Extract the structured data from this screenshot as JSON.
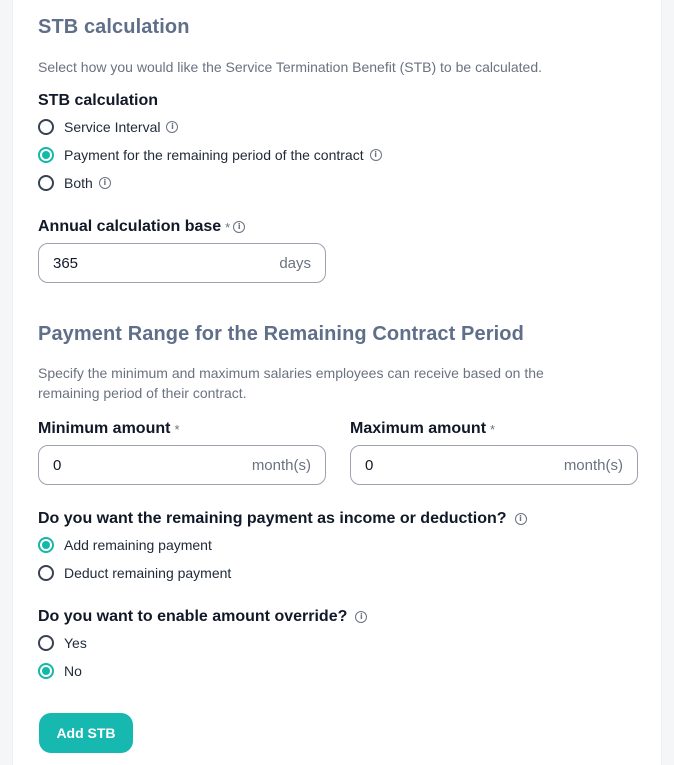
{
  "stb": {
    "heading": "STB calculation",
    "description": "Select how you would like the Service Termination Benefit (STB) to be calculated.",
    "group_label": "STB calculation",
    "options": [
      {
        "label": "Service Interval",
        "selected": false
      },
      {
        "label": "Payment for the remaining period of the contract",
        "selected": true
      },
      {
        "label": "Both",
        "selected": false
      }
    ],
    "base_label": "Annual calculation base",
    "base_value": "365",
    "base_unit": "days"
  },
  "range": {
    "heading": "Payment Range for the Remaining Contract Period",
    "description_line1": "Specify the minimum and maximum salaries employees can receive based on the",
    "description_line2": "remaining period of their contract.",
    "min_label": "Minimum amount",
    "min_value": "0",
    "min_unit": "month(s)",
    "max_label": "Maximum amount",
    "max_value": "0",
    "max_unit": "month(s)"
  },
  "income": {
    "question": "Do you want the remaining payment as income or deduction?",
    "options": [
      {
        "label": "Add remaining payment",
        "selected": true
      },
      {
        "label": "Deduct remaining payment",
        "selected": false
      }
    ]
  },
  "override": {
    "question": "Do you want to enable amount override?",
    "options": [
      {
        "label": "Yes",
        "selected": false
      },
      {
        "label": "No",
        "selected": true
      }
    ]
  },
  "actions": {
    "add_label": "Add STB"
  },
  "icons": {
    "info": "info-icon",
    "required": "required-asterisk"
  },
  "colors": {
    "accent": "#14b8a6",
    "button": "#17b8b0",
    "heading": "#5f6f8a"
  },
  "required_mark": "*",
  "info_glyph": "i"
}
